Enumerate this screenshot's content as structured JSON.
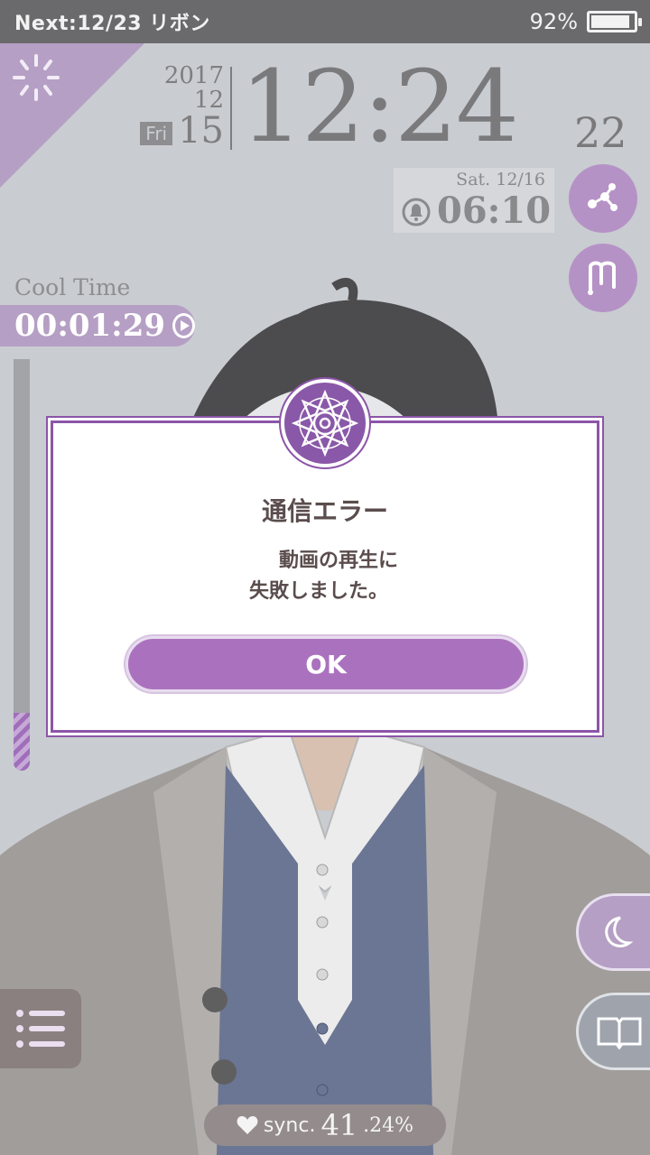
{
  "status_bar": {
    "next_event": "Next:12/23 リボン",
    "battery_percent": "92%",
    "battery_level": 0.92
  },
  "clock": {
    "year": "2017",
    "month": "12",
    "day_of_week": "Fri",
    "day": "15",
    "time": "12:24",
    "seconds": "22"
  },
  "alarm": {
    "date": "Sat.  12/16",
    "time": "06:10",
    "icon": "bell-icon"
  },
  "cool_time": {
    "label": "Cool Time",
    "value": "00:01:29",
    "gauge_level": 0.14
  },
  "dialog": {
    "title": "通信エラー",
    "message_line1": "動画の再生に",
    "message_line2": "失敗しました。",
    "ok_label": "OK"
  },
  "sync": {
    "label": "sync.",
    "integer": "41",
    "decimal": ".24%"
  },
  "icons": {
    "share": "share-icon",
    "m_logo": "m-logo-icon",
    "moon": "moon-icon",
    "book": "book-icon",
    "menu": "menu-icon",
    "heart": "heart-icon",
    "loader": "loading-spinner-icon",
    "emblem": "flower-emblem-icon"
  },
  "colors": {
    "accent": "#aa72be",
    "dialog_border": "#8c55a8",
    "status_bar": "#6a6a6c",
    "text_dark": "#5b4d4d"
  }
}
